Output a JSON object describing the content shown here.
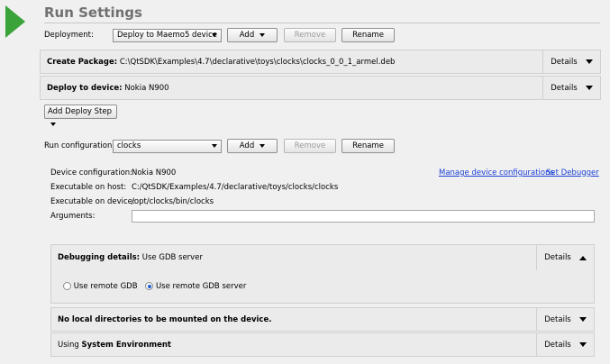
{
  "header": {
    "title": "Run Settings"
  },
  "deployment": {
    "label": "Deployment:",
    "selected": "Deploy to Maemo5 device",
    "add_label": "Add",
    "remove_label": "Remove",
    "rename_label": "Rename"
  },
  "deploy_steps": [
    {
      "title": "Create Package:",
      "value": "C:\\QtSDK\\Examples\\4.7\\declarative\\toys\\clocks\\clocks_0_0_1_armel.deb",
      "details": "Details"
    },
    {
      "title": "Deploy to device:",
      "value": "Nokia N900",
      "details": "Details"
    }
  ],
  "add_deploy_step_label": "Add Deploy Step",
  "run_config": {
    "label": "Run configuration:",
    "selected": "clocks",
    "add_label": "Add",
    "remove_label": "Remove",
    "rename_label": "Rename"
  },
  "info": {
    "device_config_label": "Device configuration:",
    "device_config_value": "Nokia N900",
    "exec_host_label": "Executable on host:",
    "exec_host_value": "C:/QtSDK/Examples/4.7/declarative/toys/clocks/clocks",
    "exec_device_label": "Executable on device:",
    "exec_device_value": "/opt/clocks/bin/clocks",
    "arguments_label": "Arguments:",
    "arguments_value": "",
    "manage_link": "Manage device configurations",
    "debugger_link": "Set Debugger"
  },
  "debugging": {
    "title": "Debugging details:",
    "value": "Use GDB server",
    "details": "Details",
    "option_remote_gdb": "Use remote GDB",
    "option_remote_gdb_server": "Use remote GDB server",
    "selected": "Use remote GDB server"
  },
  "mounts": {
    "title": "No local directories to be mounted on the device.",
    "details": "Details"
  },
  "environment": {
    "prefix": "Using",
    "bold": "System Environment",
    "details": "Details"
  },
  "colors": {
    "accent_green": "#3aa33a",
    "link_blue": "#1a3fd4",
    "radio_blue": "#1f5fd1"
  }
}
